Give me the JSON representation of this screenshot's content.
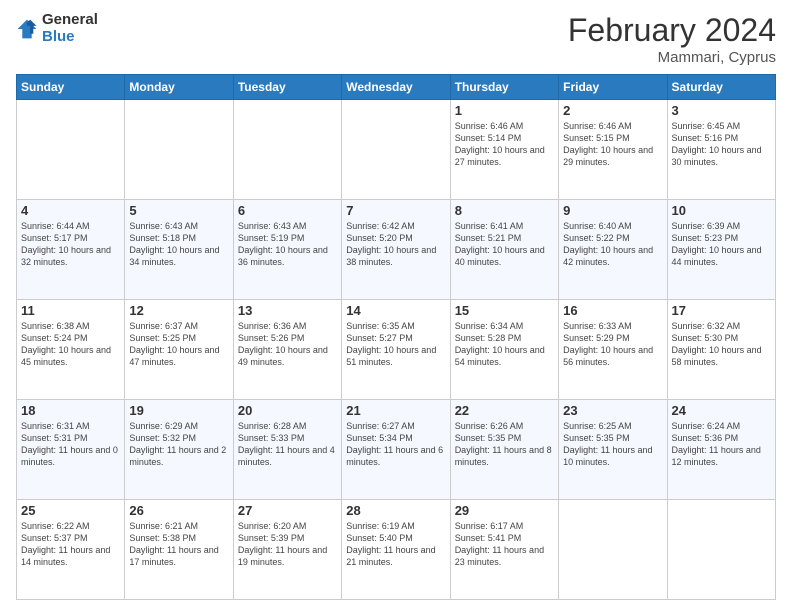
{
  "header": {
    "logo_general": "General",
    "logo_blue": "Blue",
    "title": "February 2024",
    "location": "Mammari, Cyprus"
  },
  "days_of_week": [
    "Sunday",
    "Monday",
    "Tuesday",
    "Wednesday",
    "Thursday",
    "Friday",
    "Saturday"
  ],
  "weeks": [
    [
      {
        "day": "",
        "info": ""
      },
      {
        "day": "",
        "info": ""
      },
      {
        "day": "",
        "info": ""
      },
      {
        "day": "",
        "info": ""
      },
      {
        "day": "1",
        "info": "Sunrise: 6:46 AM\nSunset: 5:14 PM\nDaylight: 10 hours and 27 minutes."
      },
      {
        "day": "2",
        "info": "Sunrise: 6:46 AM\nSunset: 5:15 PM\nDaylight: 10 hours and 29 minutes."
      },
      {
        "day": "3",
        "info": "Sunrise: 6:45 AM\nSunset: 5:16 PM\nDaylight: 10 hours and 30 minutes."
      }
    ],
    [
      {
        "day": "4",
        "info": "Sunrise: 6:44 AM\nSunset: 5:17 PM\nDaylight: 10 hours and 32 minutes."
      },
      {
        "day": "5",
        "info": "Sunrise: 6:43 AM\nSunset: 5:18 PM\nDaylight: 10 hours and 34 minutes."
      },
      {
        "day": "6",
        "info": "Sunrise: 6:43 AM\nSunset: 5:19 PM\nDaylight: 10 hours and 36 minutes."
      },
      {
        "day": "7",
        "info": "Sunrise: 6:42 AM\nSunset: 5:20 PM\nDaylight: 10 hours and 38 minutes."
      },
      {
        "day": "8",
        "info": "Sunrise: 6:41 AM\nSunset: 5:21 PM\nDaylight: 10 hours and 40 minutes."
      },
      {
        "day": "9",
        "info": "Sunrise: 6:40 AM\nSunset: 5:22 PM\nDaylight: 10 hours and 42 minutes."
      },
      {
        "day": "10",
        "info": "Sunrise: 6:39 AM\nSunset: 5:23 PM\nDaylight: 10 hours and 44 minutes."
      }
    ],
    [
      {
        "day": "11",
        "info": "Sunrise: 6:38 AM\nSunset: 5:24 PM\nDaylight: 10 hours and 45 minutes."
      },
      {
        "day": "12",
        "info": "Sunrise: 6:37 AM\nSunset: 5:25 PM\nDaylight: 10 hours and 47 minutes."
      },
      {
        "day": "13",
        "info": "Sunrise: 6:36 AM\nSunset: 5:26 PM\nDaylight: 10 hours and 49 minutes."
      },
      {
        "day": "14",
        "info": "Sunrise: 6:35 AM\nSunset: 5:27 PM\nDaylight: 10 hours and 51 minutes."
      },
      {
        "day": "15",
        "info": "Sunrise: 6:34 AM\nSunset: 5:28 PM\nDaylight: 10 hours and 54 minutes."
      },
      {
        "day": "16",
        "info": "Sunrise: 6:33 AM\nSunset: 5:29 PM\nDaylight: 10 hours and 56 minutes."
      },
      {
        "day": "17",
        "info": "Sunrise: 6:32 AM\nSunset: 5:30 PM\nDaylight: 10 hours and 58 minutes."
      }
    ],
    [
      {
        "day": "18",
        "info": "Sunrise: 6:31 AM\nSunset: 5:31 PM\nDaylight: 11 hours and 0 minutes."
      },
      {
        "day": "19",
        "info": "Sunrise: 6:29 AM\nSunset: 5:32 PM\nDaylight: 11 hours and 2 minutes."
      },
      {
        "day": "20",
        "info": "Sunrise: 6:28 AM\nSunset: 5:33 PM\nDaylight: 11 hours and 4 minutes."
      },
      {
        "day": "21",
        "info": "Sunrise: 6:27 AM\nSunset: 5:34 PM\nDaylight: 11 hours and 6 minutes."
      },
      {
        "day": "22",
        "info": "Sunrise: 6:26 AM\nSunset: 5:35 PM\nDaylight: 11 hours and 8 minutes."
      },
      {
        "day": "23",
        "info": "Sunrise: 6:25 AM\nSunset: 5:35 PM\nDaylight: 11 hours and 10 minutes."
      },
      {
        "day": "24",
        "info": "Sunrise: 6:24 AM\nSunset: 5:36 PM\nDaylight: 11 hours and 12 minutes."
      }
    ],
    [
      {
        "day": "25",
        "info": "Sunrise: 6:22 AM\nSunset: 5:37 PM\nDaylight: 11 hours and 14 minutes."
      },
      {
        "day": "26",
        "info": "Sunrise: 6:21 AM\nSunset: 5:38 PM\nDaylight: 11 hours and 17 minutes."
      },
      {
        "day": "27",
        "info": "Sunrise: 6:20 AM\nSunset: 5:39 PM\nDaylight: 11 hours and 19 minutes."
      },
      {
        "day": "28",
        "info": "Sunrise: 6:19 AM\nSunset: 5:40 PM\nDaylight: 11 hours and 21 minutes."
      },
      {
        "day": "29",
        "info": "Sunrise: 6:17 AM\nSunset: 5:41 PM\nDaylight: 11 hours and 23 minutes."
      },
      {
        "day": "",
        "info": ""
      },
      {
        "day": "",
        "info": ""
      }
    ]
  ]
}
